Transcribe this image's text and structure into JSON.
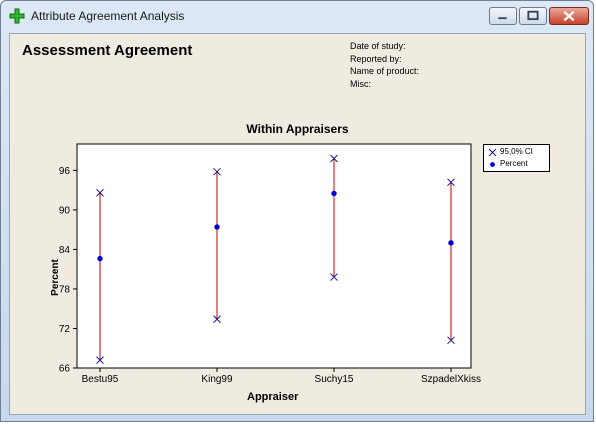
{
  "window": {
    "title": "Attribute Agreement Analysis",
    "icon": "green-plus-icon",
    "buttons": [
      "minimize",
      "maximize",
      "close"
    ]
  },
  "report": {
    "heading": "Assessment Agreement",
    "meta": [
      "Date of study:",
      "Reported by:",
      "Name of product:",
      "Misc:"
    ]
  },
  "chart_data": {
    "type": "scatter",
    "title": "Within Appraisers",
    "xlabel": "Appraiser",
    "ylabel": "Percent",
    "categories": [
      "Bestu95",
      "King99",
      "Suchy15",
      "SzpadelXkiss"
    ],
    "series": [
      {
        "name": "Percent",
        "values": [
          82.6,
          87.4,
          92.5,
          85.0
        ],
        "color": "#0000cc",
        "marker": "dot"
      },
      {
        "name": "95,0% CI",
        "lower": [
          67.2,
          73.4,
          79.8,
          70.2
        ],
        "upper": [
          92.6,
          95.8,
          97.8,
          94.2
        ],
        "color": "#1a1a8c",
        "marker": "x"
      }
    ],
    "interval_line_color": "#cc0000",
    "ylim": [
      66,
      100
    ],
    "yticks": [
      66,
      72,
      78,
      84,
      90,
      96
    ],
    "legend_position": "right"
  }
}
